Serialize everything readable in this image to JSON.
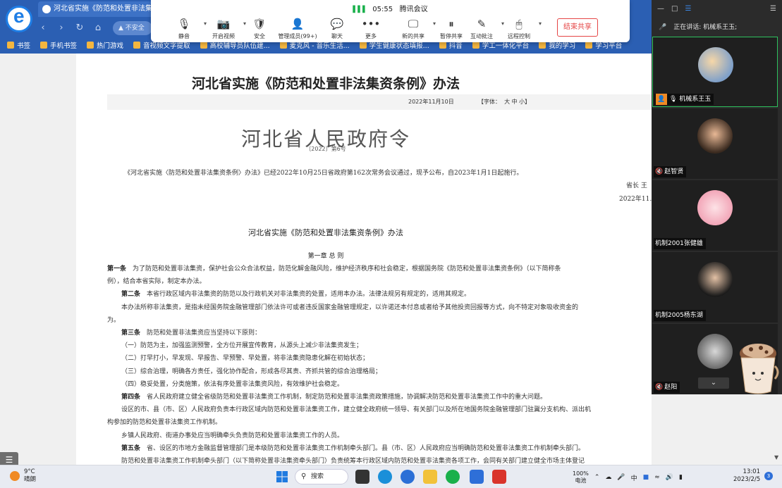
{
  "browser": {
    "tab_title": "河北省实施《防范和处置非法集资...",
    "address_text": "不安全",
    "nav_icons": [
      "back-icon",
      "forward-icon",
      "refresh-icon",
      "home-icon"
    ]
  },
  "bookmarks": [
    "书签",
    "手机书签",
    "热门游戏",
    "音视频文字提取",
    "高校辅导员队伍建...",
    "麦克风 - 音乐生活...",
    "学生健康状态填报...",
    "抖音",
    "学工一体化平台",
    "我的学习",
    "学习平台"
  ],
  "meeting": {
    "time": "05:55",
    "app_name": "腾讯会议",
    "buttons": [
      {
        "label": "静音",
        "icon": "mic-icon",
        "has_menu": true
      },
      {
        "label": "开启视频",
        "icon": "camera-off-icon",
        "has_menu": true
      },
      {
        "label": "安全",
        "icon": "shield-icon",
        "has_menu": false
      },
      {
        "label": "管理成员(99+)",
        "icon": "members-icon",
        "has_menu": false
      },
      {
        "label": "聊天",
        "icon": "chat-icon",
        "has_menu": false
      },
      {
        "label": "更多",
        "icon": "more-icon",
        "has_menu": false
      },
      {
        "label": "新的共享",
        "icon": "share-icon",
        "has_menu": true
      },
      {
        "label": "暂停共享",
        "icon": "pause-icon",
        "has_menu": false
      },
      {
        "label": "互动批注",
        "icon": "annotate-icon",
        "has_menu": true
      },
      {
        "label": "远程控制",
        "icon": "remote-icon",
        "has_menu": true
      }
    ],
    "end_share_label": "结束共享"
  },
  "document": {
    "title": "河北省实施《防范和处置非法集资条例》办法",
    "date": "2022年11月10日",
    "font_label": "【字体：",
    "font_options": "大 中 小】",
    "gov_order_title": "河北省人民政府令",
    "gov_order_no": "〔2022〕第6号",
    "intro": "《河北省实施〈防范和处置非法集资条例〉办法》已经2022年10月25日省政府第162次常务会议通过，现予公布，自2023年1月1日起施行。",
    "signer": "省长  王",
    "sign_date": "2022年11.",
    "sub_title": "河北省实施《防范和处置非法集资条例》办法",
    "chapter": "第一章  总    则",
    "paragraphs": [
      {
        "head": "第一条",
        "text": "为了防范和处置非法集资，保护社会公众合法权益，防范化解金融风险，维护经济秩序和社会稳定，根据国务院《防范和处置非法集资条例》（以下简称条"
      },
      {
        "head": "",
        "text": "例），结合本省实际，制定本办法。"
      },
      {
        "head": "第二条",
        "text": "本省行政区域内非法集资的防范以及行政机关对非法集资的处置，适用本办法。法律法规另有规定的，适用其规定。"
      },
      {
        "head": "",
        "text": "本办法所称非法集资，是指未经国务院金融管理部门依法许可或者违反国家金融管理规定，以许诺还本付息或者给予其他投资回报等方式，向不特定对象吸收资金的"
      },
      {
        "head": "",
        "text": "为。"
      },
      {
        "head": "第三条",
        "text": "防范和处置非法集资应当坚持以下原则："
      },
      {
        "head": "",
        "text": "（一）防范为主，加强监测预警，全方位开展宣传教育，从源头上减少非法集资发生；"
      },
      {
        "head": "",
        "text": "（二）打早打小，早发现、早报告、早预警、早处置，将非法集资隐患化解在初始状态；"
      },
      {
        "head": "",
        "text": "（三）综合治理，明确各方责任，强化协作配合，形成各尽其责、齐抓共管的综合治理格局；"
      },
      {
        "head": "",
        "text": "（四）稳妥处置，分类施策，依法有序处置非法集资风险，有效维护社会稳定。"
      },
      {
        "head": "第四条",
        "text": "省人民政府建立健全省级防范和处置非法集资工作机制，制定防范和处置非法集资政策措施，协调解决防范和处置非法集资工作中的重大问题。"
      },
      {
        "head": "",
        "text": "设区的市、县（市、区）人民政府负责本行政区域内防范和处置非法集资工作，建立健全政府统一领导、有关部门以及所在地国务院金融管理部门驻冀分支机构、派出机"
      },
      {
        "head": "",
        "text": "构参加的防范和处置非法集资工作机制。"
      },
      {
        "head": "",
        "text": "乡镇人民政府、街道办事处应当明确牵头负责防范和处置非法集资工作的人员。"
      },
      {
        "head": "第五条",
        "text": "省、设区的市地方金融监督管理部门是本级防范和处置非法集资工作机制牵头部门。县（市、区）人民政府应当明确防范和处置非法集资工作机制牵头部门。"
      },
      {
        "head": "",
        "text": "防范和处置非法集资工作机制牵头部门（以下简称处置非法集资牵头部门）负责统筹本行政区域内防范和处置非法集资各项工作，会同有关部门建立健全市场主体登记"
      }
    ]
  },
  "panel": {
    "speaking_label": "正在讲话: 机械系王玉;",
    "participants": [
      {
        "name": "机械系王玉",
        "host": true,
        "muted": false,
        "active": true
      },
      {
        "name": "赵智贤",
        "host": false,
        "muted": true,
        "active": false
      },
      {
        "name": "机制2001张健雄",
        "host": false,
        "muted": false,
        "active": false
      },
      {
        "name": "机制2005杨东湖",
        "host": false,
        "muted": false,
        "active": false
      },
      {
        "name": "赵阳",
        "host": false,
        "muted": true,
        "active": false
      }
    ]
  },
  "taskbar": {
    "weather_temp": "9°C",
    "weather_desc": "晴朗",
    "search_label": "搜索",
    "battery_pct": "100%",
    "battery_label": "电池",
    "time": "13:01",
    "date": "2023/2/5",
    "notifications": "3"
  }
}
